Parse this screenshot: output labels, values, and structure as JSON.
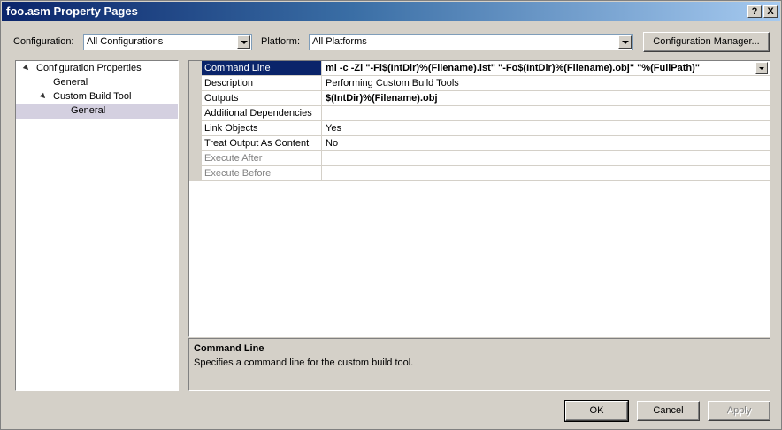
{
  "window": {
    "title": "foo.asm Property Pages",
    "help_label": "?",
    "close_label": "X"
  },
  "config": {
    "configuration_label": "Configuration:",
    "configuration_value": "All Configurations",
    "platform_label": "Platform:",
    "platform_value": "All Platforms",
    "manager_button": "Configuration Manager..."
  },
  "tree": {
    "items": [
      {
        "label": "Configuration Properties",
        "expanded": true
      },
      {
        "label": "General"
      },
      {
        "label": "Custom Build Tool",
        "expanded": true
      },
      {
        "label": "General",
        "selected": true
      }
    ]
  },
  "grid": {
    "rows": [
      {
        "name": "Command Line",
        "value": "ml -c -Zi \"-Fl$(IntDir)%(Filename).lst\" \"-Fo$(IntDir)%(Filename).obj\" \"%(FullPath)\""
      },
      {
        "name": "Description",
        "value": "Performing Custom Build Tools"
      },
      {
        "name": "Outputs",
        "value": "$(IntDir)%(Filename).obj"
      },
      {
        "name": "Additional Dependencies",
        "value": ""
      },
      {
        "name": "Link Objects",
        "value": "Yes"
      },
      {
        "name": "Treat Output As Content",
        "value": "No"
      },
      {
        "name": "Execute After",
        "value": ""
      },
      {
        "name": "Execute Before",
        "value": ""
      }
    ]
  },
  "description": {
    "title": "Command Line",
    "text": "Specifies a command line for the custom build tool."
  },
  "buttons": {
    "ok": "OK",
    "cancel": "Cancel",
    "apply": "Apply"
  },
  "colors": {
    "titlebar_start": "#0a246a",
    "titlebar_end": "#a6caf0",
    "selection": "#0a246a",
    "face": "#d4d0c8"
  }
}
